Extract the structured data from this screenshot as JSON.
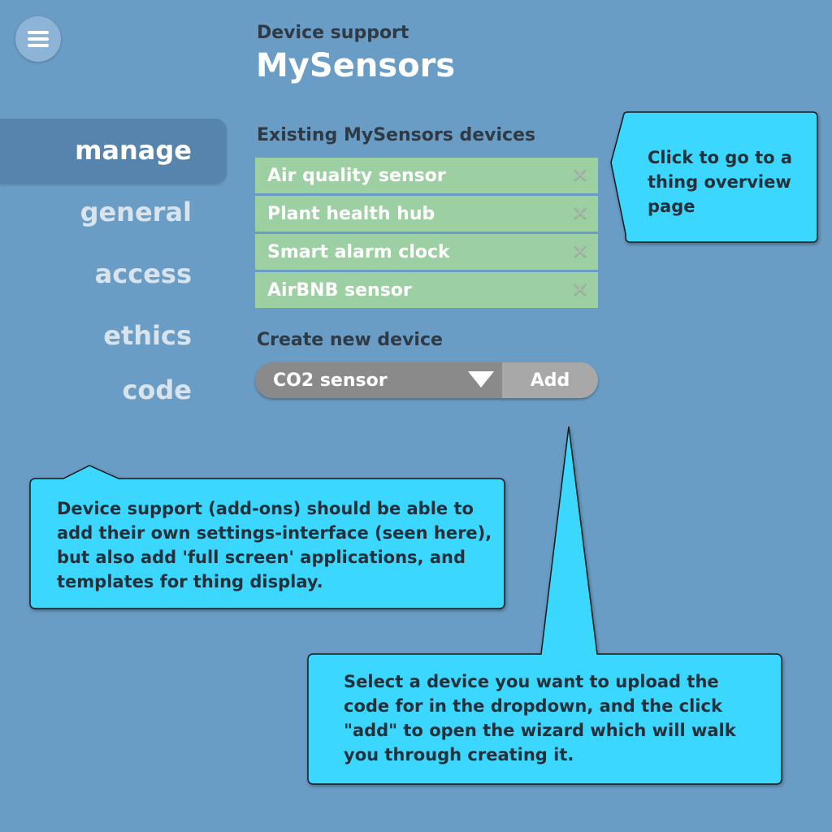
{
  "header": {
    "subtitle": "Device support",
    "title": "MySensors"
  },
  "sidebar": {
    "items": [
      {
        "label": "manage",
        "active": true
      },
      {
        "label": "general",
        "active": false
      },
      {
        "label": "access",
        "active": false
      },
      {
        "label": "ethics",
        "active": false
      },
      {
        "label": "code",
        "active": false
      }
    ]
  },
  "existing": {
    "heading": "Existing MySensors devices",
    "devices": [
      {
        "name": "Air quality sensor"
      },
      {
        "name": "Plant health hub"
      },
      {
        "name": "Smart alarm clock"
      },
      {
        "name": "AirBNB sensor"
      }
    ]
  },
  "create": {
    "heading": "Create new device",
    "selected": "CO2 sensor",
    "add_label": "Add"
  },
  "annotations": {
    "overview": "Click to go to a thing overview page",
    "addons": "Device support (add-ons) should be able to add their own settings-interface (seen here), but also add 'full screen' applications, and templates for thing display.",
    "wizard": "Select a device you want to upload the code for in the dropdown, and the click \"add\" to open the wizard which will walk you through creating it."
  },
  "colors": {
    "background": "#6a9dc5",
    "device_row": "#9ccfa1",
    "callout": "#3bd7fe",
    "dropdown": "#8a8a8a",
    "add_button": "#a8a8a8"
  }
}
